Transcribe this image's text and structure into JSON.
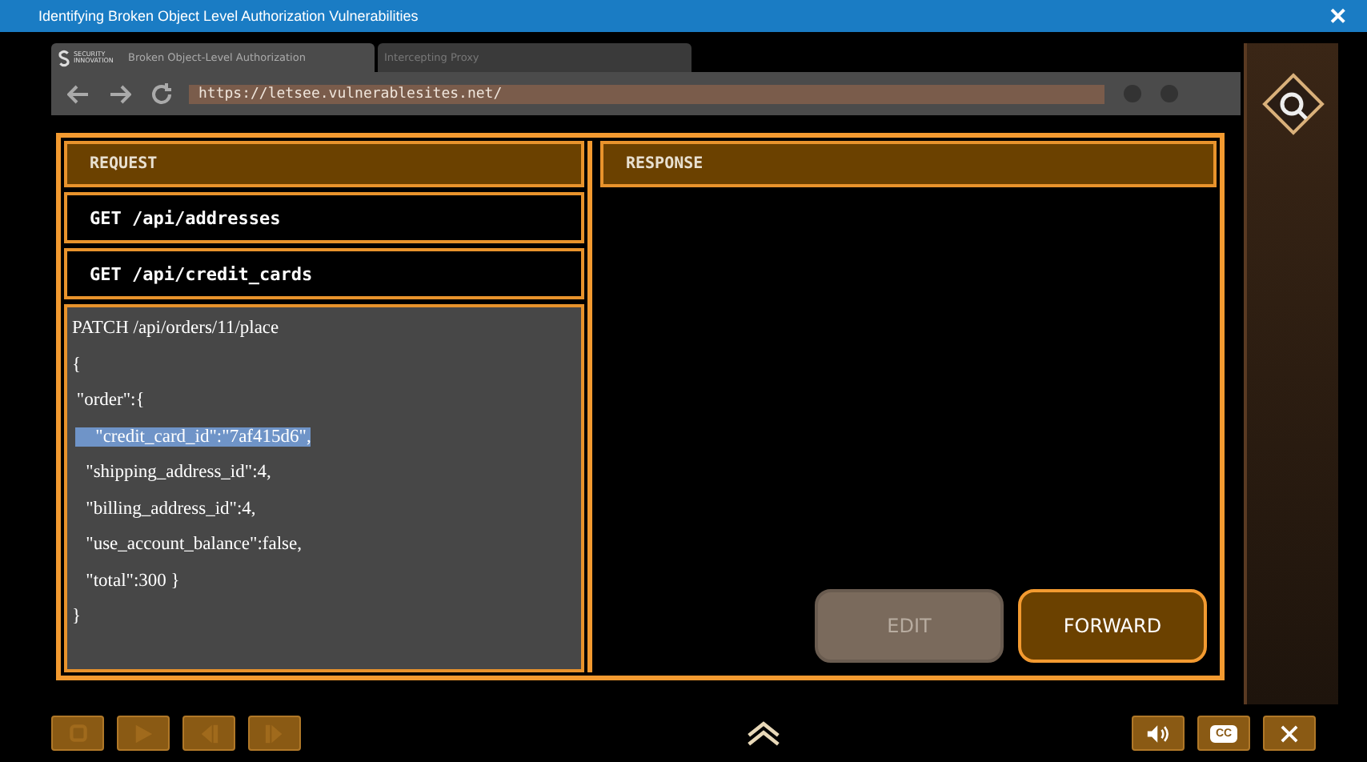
{
  "window": {
    "title": "Identifying Broken Object Level Authorization Vulnerabilities",
    "close": "✕"
  },
  "browser": {
    "logo": "SECURITY INNOVATION",
    "tabs": [
      {
        "label": "Broken Object-Level Authorization",
        "selected": true
      },
      {
        "label": "Intercepting Proxy",
        "selected": false
      }
    ],
    "url": "https://letsee.vulnerablesites.net/"
  },
  "request": {
    "title": "REQUEST",
    "items": [
      "GET /api/addresses",
      "GET /api/credit_cards"
    ],
    "body": [
      {
        "text": "PATCH /api/orders/11/place",
        "highlighted": false
      },
      {
        "text": "{",
        "highlighted": false
      },
      {
        "text": " \"order\":{",
        "highlighted": false
      },
      {
        "text": "   \"credit_card_id\":\"7af415d6\",",
        "highlighted": true
      },
      {
        "text": "   \"shipping_address_id\":4,",
        "highlighted": false
      },
      {
        "text": "   \"billing_address_id\":4,",
        "highlighted": false
      },
      {
        "text": "   \"use_account_balance\":false,",
        "highlighted": false
      },
      {
        "text": "   \"total\":300 }",
        "highlighted": false
      },
      {
        "text": "}",
        "highlighted": false
      }
    ]
  },
  "response": {
    "title": "RESPONSE"
  },
  "buttons": [
    {
      "label": "EDIT",
      "disabled": true
    },
    {
      "label": "FORWARD",
      "disabled": false
    }
  ],
  "controls": {
    "left": [
      {
        "kind": "replay"
      },
      {
        "kind": "play"
      },
      {
        "kind": "back"
      },
      {
        "kind": "next"
      }
    ],
    "right": [
      {
        "kind": "volume"
      },
      {
        "kind": "cc",
        "label": "CC"
      },
      {
        "kind": "close"
      }
    ]
  }
}
